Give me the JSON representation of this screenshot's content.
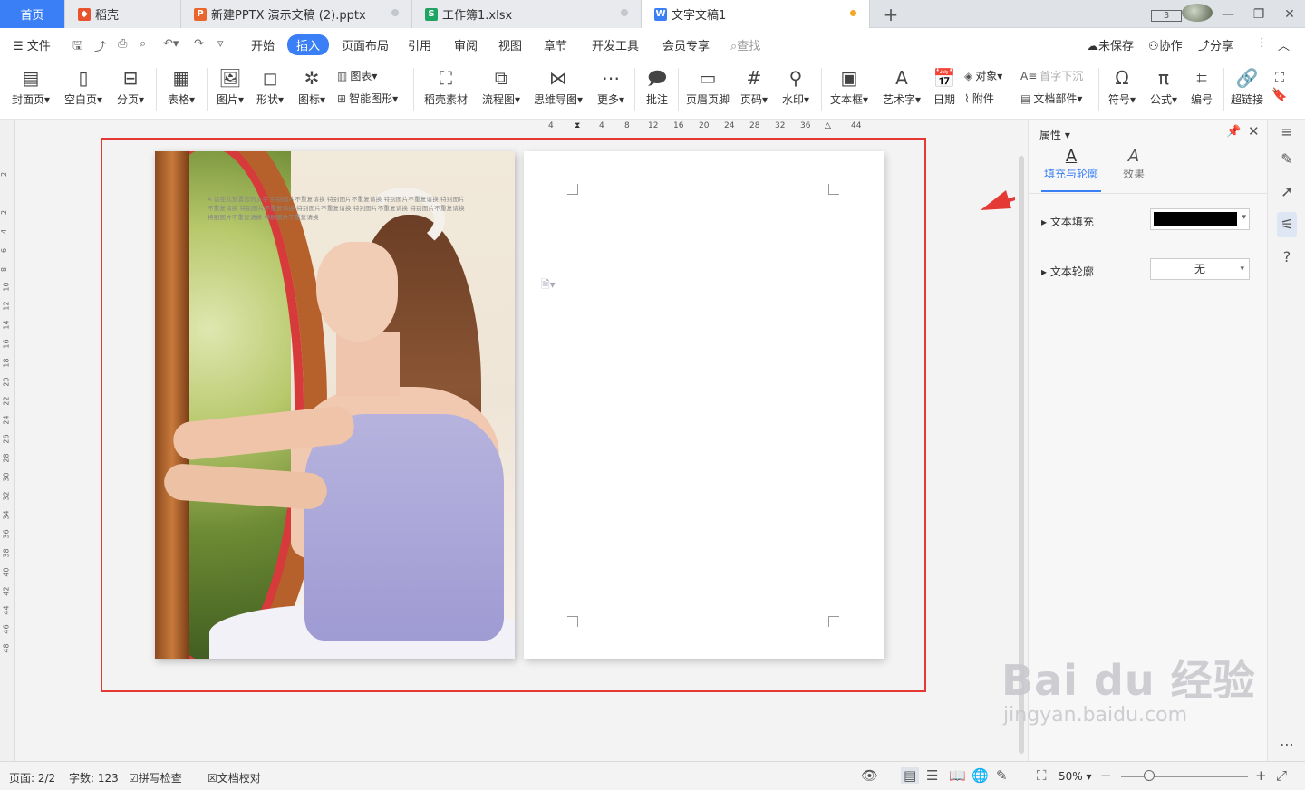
{
  "tabs": {
    "home": "首页",
    "items": [
      {
        "label": "稻壳",
        "icon": "daoke-icon",
        "color": "#e8522d"
      },
      {
        "label": "新建PPTX 演示文稿 (2).pptx",
        "icon": "ppt-icon",
        "color": "#e8662d"
      },
      {
        "label": "工作簿1.xlsx",
        "icon": "xlsx-icon",
        "color": "#1fa463"
      },
      {
        "label": "文字文稿1",
        "icon": "doc-icon",
        "color": "#3a7ff5"
      }
    ],
    "add": "+"
  },
  "window": {
    "badge": "3"
  },
  "menu": {
    "file": "文件",
    "items": [
      "开始",
      "插入",
      "页面布局",
      "引用",
      "审阅",
      "视图",
      "章节",
      "开发工具",
      "会员专享"
    ],
    "active": "插入",
    "search": "查找",
    "unsaved": "未保存",
    "collab": "协作",
    "share": "分享"
  },
  "ribbon": {
    "cover": "封面页",
    "blank": "空白页",
    "pagebreak": "分页",
    "table": "表格",
    "picture": "图片",
    "shape": "形状",
    "iconlib": "图标",
    "chart": "图表",
    "smartart": "智能图形",
    "material": "稻壳素材",
    "flowchart": "流程图",
    "mindmap": "思维导图",
    "more": "更多",
    "comment": "批注",
    "headerfooter": "页眉页脚",
    "pagenum": "页码",
    "watermark": "水印",
    "textbox": "文本框",
    "wordart": "艺术字",
    "date": "日期",
    "object": "对象",
    "attachment": "附件",
    "dropcap": "首字下沉",
    "docparts": "文档部件",
    "symbol": "符号",
    "formula": "公式",
    "numbering": "编号",
    "hyperlink": "超链接"
  },
  "ruler": {
    "h": [
      "4",
      "",
      "4",
      "8",
      "12",
      "16",
      "20",
      "24",
      "28",
      "32",
      "36",
      "",
      "44"
    ],
    "v": [
      "2",
      "",
      "2",
      "4",
      "6",
      "8",
      "10",
      "12",
      "14",
      "16",
      "18",
      "20",
      "22",
      "24",
      "26",
      "28",
      "30",
      "32",
      "34",
      "36",
      "38",
      "40",
      "42",
      "44",
      "46",
      "48"
    ]
  },
  "overlay_text": "A 请在此放置您的文字 特别图片不重复请换 特别图片不重复请换 特别图片不重复请换 特别图片 不重复请换 特别图片不重复请换 特别图片不重复请换 特别图片不重复请换 特别图片不重复请换 特别图片不重复请换 特别图片不重复请换",
  "panel": {
    "title": "属性",
    "tab_fill": "填充与轮廓",
    "tab_effect": "效果",
    "text_fill": "文本填充",
    "fill_color": "#000000",
    "text_outline": "文本轮廓",
    "outline_value": "无"
  },
  "status": {
    "page": "页面: 2/2",
    "words": "字数: 123",
    "spell": "拼写检查",
    "proof": "文档校对",
    "zoom": "50%"
  },
  "brand_watermark": {
    "big": "Bai du 经验",
    "small": "jingyan.baidu.com"
  }
}
